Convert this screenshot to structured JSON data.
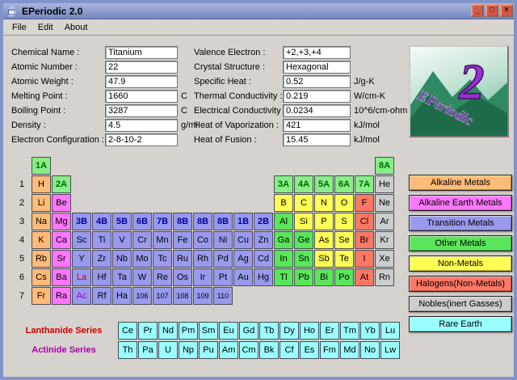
{
  "window": {
    "title": "EPeriodic 2.0",
    "menus": [
      "File",
      "Edit",
      "About"
    ],
    "controls": [
      {
        "name": "minimize-button",
        "glyph": "_"
      },
      {
        "name": "maximize-button",
        "glyph": "□"
      },
      {
        "name": "close-button",
        "glyph": "×"
      }
    ]
  },
  "form": {
    "left": [
      {
        "label": "Chemical Name :",
        "value": "Titanium",
        "unit": ""
      },
      {
        "label": "Atomic Number :",
        "value": "22",
        "unit": ""
      },
      {
        "label": "Atomic Weight :",
        "value": "47.9",
        "unit": ""
      },
      {
        "label": "Melting Point :",
        "value": "1660",
        "unit": "C"
      },
      {
        "label": "Boiling Point :",
        "value": "3287",
        "unit": "C"
      },
      {
        "label": "Density :",
        "value": "4.5",
        "unit": "g/ml"
      },
      {
        "label": "Electron Configuration :",
        "value": "2-8-10-2",
        "unit": ""
      }
    ],
    "right": [
      {
        "label": "Valence Electron :",
        "value": "+2,+3,+4",
        "unit": ""
      },
      {
        "label": "Crystal Structure :",
        "value": "Hexagonal",
        "unit": ""
      },
      {
        "label": "Specific Heat :",
        "value": "0.52",
        "unit": "J/g-K"
      },
      {
        "label": "Thermal Conductivity :",
        "value": "0.219",
        "unit": "W/cm-K"
      },
      {
        "label": "Electrical Conductivity :",
        "value": "0.0234",
        "unit": "10^6/cm-ohm"
      },
      {
        "label": "Heat of Vaporization :",
        "value": "421",
        "unit": "kJ/mol"
      },
      {
        "label": "Heat of Fusion :",
        "value": "15.45",
        "unit": "kJ/mol"
      }
    ]
  },
  "logo": {
    "numeral": "2",
    "text": "EPeriodic"
  },
  "colors": {
    "alkaline": "#ffbb77",
    "alkaline_earth": "#ff77ff",
    "transition": "#9999ee",
    "other_metal": "#5ae65a",
    "non_metal": "#ffff55",
    "halogen": "#ff7766",
    "noble": "#cccccc",
    "rare_earth": "#99ffff",
    "group_a_bg": "#88ee88",
    "group_a_text": "#006600",
    "group_b_bg": "#9999ee",
    "group_b_text": "#000099",
    "lanthanide_text": "#cc0000",
    "actinide_text": "#aa00aa"
  },
  "table": {
    "header": [
      {
        "label": "1A",
        "col": 1
      },
      {
        "label": "8A",
        "col": 18
      }
    ],
    "rows": [
      {
        "num": "1",
        "cells": [
          {
            "sym": "H",
            "col": 1,
            "cat": "alkaline"
          },
          {
            "sym": "2A",
            "col": 2,
            "cat": "group_a"
          },
          {
            "sym": "3A",
            "col": 13,
            "cat": "group_a"
          },
          {
            "sym": "4A",
            "col": 14,
            "cat": "group_a"
          },
          {
            "sym": "5A",
            "col": 15,
            "cat": "group_a"
          },
          {
            "sym": "6A",
            "col": 16,
            "cat": "group_a"
          },
          {
            "sym": "7A",
            "col": 17,
            "cat": "group_a"
          },
          {
            "sym": "He",
            "col": 18,
            "cat": "noble"
          }
        ]
      },
      {
        "num": "2",
        "cells": [
          {
            "sym": "Li",
            "col": 1,
            "cat": "alkaline"
          },
          {
            "sym": "Be",
            "col": 2,
            "cat": "alkaline_earth"
          },
          {
            "sym": "B",
            "col": 13,
            "cat": "non_metal"
          },
          {
            "sym": "C",
            "col": 14,
            "cat": "non_metal"
          },
          {
            "sym": "N",
            "col": 15,
            "cat": "non_metal"
          },
          {
            "sym": "O",
            "col": 16,
            "cat": "non_metal"
          },
          {
            "sym": "F",
            "col": 17,
            "cat": "halogen"
          },
          {
            "sym": "Ne",
            "col": 18,
            "cat": "noble"
          }
        ]
      },
      {
        "num": "3",
        "cells": [
          {
            "sym": "Na",
            "col": 1,
            "cat": "alkaline"
          },
          {
            "sym": "Mg",
            "col": 2,
            "cat": "alkaline_earth"
          },
          {
            "sym": "3B",
            "col": 3,
            "cat": "group_b"
          },
          {
            "sym": "4B",
            "col": 4,
            "cat": "group_b"
          },
          {
            "sym": "5B",
            "col": 5,
            "cat": "group_b"
          },
          {
            "sym": "6B",
            "col": 6,
            "cat": "group_b"
          },
          {
            "sym": "7B",
            "col": 7,
            "cat": "group_b"
          },
          {
            "sym": "8B",
            "col": 8,
            "cat": "group_b"
          },
          {
            "sym": "8B",
            "col": 9,
            "cat": "group_b"
          },
          {
            "sym": "8B",
            "col": 10,
            "cat": "group_b"
          },
          {
            "sym": "1B",
            "col": 11,
            "cat": "group_b"
          },
          {
            "sym": "2B",
            "col": 12,
            "cat": "group_b"
          },
          {
            "sym": "Al",
            "col": 13,
            "cat": "other_metal"
          },
          {
            "sym": "Si",
            "col": 14,
            "cat": "non_metal"
          },
          {
            "sym": "P",
            "col": 15,
            "cat": "non_metal"
          },
          {
            "sym": "S",
            "col": 16,
            "cat": "non_metal"
          },
          {
            "sym": "Cl",
            "col": 17,
            "cat": "halogen"
          },
          {
            "sym": "Ar",
            "col": 18,
            "cat": "noble"
          }
        ]
      },
      {
        "num": "4",
        "cells": [
          {
            "sym": "K",
            "col": 1,
            "cat": "alkaline"
          },
          {
            "sym": "Ca",
            "col": 2,
            "cat": "alkaline_earth"
          },
          {
            "sym": "Sc",
            "col": 3,
            "cat": "transition"
          },
          {
            "sym": "Ti",
            "col": 4,
            "cat": "transition"
          },
          {
            "sym": "V",
            "col": 5,
            "cat": "transition"
          },
          {
            "sym": "Cr",
            "col": 6,
            "cat": "transition"
          },
          {
            "sym": "Mn",
            "col": 7,
            "cat": "transition"
          },
          {
            "sym": "Fe",
            "col": 8,
            "cat": "transition"
          },
          {
            "sym": "Co",
            "col": 9,
            "cat": "transition"
          },
          {
            "sym": "Ni",
            "col": 10,
            "cat": "transition"
          },
          {
            "sym": "Cu",
            "col": 11,
            "cat": "transition"
          },
          {
            "sym": "Zn",
            "col": 12,
            "cat": "transition"
          },
          {
            "sym": "Ga",
            "col": 13,
            "cat": "other_metal"
          },
          {
            "sym": "Ge",
            "col": 14,
            "cat": "other_metal"
          },
          {
            "sym": "As",
            "col": 15,
            "cat": "non_metal"
          },
          {
            "sym": "Se",
            "col": 16,
            "cat": "non_metal"
          },
          {
            "sym": "Br",
            "col": 17,
            "cat": "halogen"
          },
          {
            "sym": "Kr",
            "col": 18,
            "cat": "noble"
          }
        ]
      },
      {
        "num": "5",
        "cells": [
          {
            "sym": "Rb",
            "col": 1,
            "cat": "alkaline"
          },
          {
            "sym": "Sr",
            "col": 2,
            "cat": "alkaline_earth"
          },
          {
            "sym": "Y",
            "col": 3,
            "cat": "transition"
          },
          {
            "sym": "Zr",
            "col": 4,
            "cat": "transition"
          },
          {
            "sym": "Nb",
            "col": 5,
            "cat": "transition"
          },
          {
            "sym": "Mo",
            "col": 6,
            "cat": "transition"
          },
          {
            "sym": "Tc",
            "col": 7,
            "cat": "transition"
          },
          {
            "sym": "Ru",
            "col": 8,
            "cat": "transition"
          },
          {
            "sym": "Rh",
            "col": 9,
            "cat": "transition"
          },
          {
            "sym": "Pd",
            "col": 10,
            "cat": "transition"
          },
          {
            "sym": "Ag",
            "col": 11,
            "cat": "transition"
          },
          {
            "sym": "Cd",
            "col": 12,
            "cat": "transition"
          },
          {
            "sym": "In",
            "col": 13,
            "cat": "other_metal"
          },
          {
            "sym": "Sn",
            "col": 14,
            "cat": "other_metal"
          },
          {
            "sym": "Sb",
            "col": 15,
            "cat": "non_metal"
          },
          {
            "sym": "Te",
            "col": 16,
            "cat": "non_metal"
          },
          {
            "sym": "I",
            "col": 17,
            "cat": "halogen"
          },
          {
            "sym": "Xe",
            "col": 18,
            "cat": "noble"
          }
        ]
      },
      {
        "num": "6",
        "cells": [
          {
            "sym": "Cs",
            "col": 1,
            "cat": "alkaline"
          },
          {
            "sym": "Ba",
            "col": 2,
            "cat": "alkaline_earth"
          },
          {
            "sym": "La",
            "col": 3,
            "cat": "transition",
            "fg": "lanthanide_text"
          },
          {
            "sym": "Hf",
            "col": 4,
            "cat": "transition"
          },
          {
            "sym": "Ta",
            "col": 5,
            "cat": "transition"
          },
          {
            "sym": "W",
            "col": 6,
            "cat": "transition"
          },
          {
            "sym": "Re",
            "col": 7,
            "cat": "transition"
          },
          {
            "sym": "Os",
            "col": 8,
            "cat": "transition"
          },
          {
            "sym": "Ir",
            "col": 9,
            "cat": "transition"
          },
          {
            "sym": "Pt",
            "col": 10,
            "cat": "transition"
          },
          {
            "sym": "Au",
            "col": 11,
            "cat": "transition"
          },
          {
            "sym": "Hg",
            "col": 12,
            "cat": "transition"
          },
          {
            "sym": "Tl",
            "col": 13,
            "cat": "other_metal"
          },
          {
            "sym": "Pb",
            "col": 14,
            "cat": "other_metal"
          },
          {
            "sym": "Bi",
            "col": 15,
            "cat": "other_metal"
          },
          {
            "sym": "Po",
            "col": 16,
            "cat": "other_metal"
          },
          {
            "sym": "At",
            "col": 17,
            "cat": "halogen"
          },
          {
            "sym": "Rn",
            "col": 18,
            "cat": "noble"
          }
        ]
      },
      {
        "num": "7",
        "cells": [
          {
            "sym": "Fr",
            "col": 1,
            "cat": "alkaline"
          },
          {
            "sym": "Ra",
            "col": 2,
            "cat": "alkaline_earth"
          },
          {
            "sym": "Ac",
            "col": 3,
            "cat": "transition",
            "fg": "actinide_text"
          },
          {
            "sym": "Rf",
            "col": 4,
            "cat": "transition"
          },
          {
            "sym": "Ha",
            "col": 5,
            "cat": "transition"
          },
          {
            "sym": "106",
            "col": 6,
            "cat": "transition"
          },
          {
            "sym": "107",
            "col": 7,
            "cat": "transition"
          },
          {
            "sym": "108",
            "col": 8,
            "cat": "transition"
          },
          {
            "sym": "109",
            "col": 9,
            "cat": "transition"
          },
          {
            "sym": "110",
            "col": 10,
            "cat": "transition"
          }
        ]
      }
    ]
  },
  "legend": [
    {
      "label": "Alkaline Metals",
      "cat": "alkaline"
    },
    {
      "label": "Alkaline Earth Metals",
      "cat": "alkaline_earth"
    },
    {
      "label": "Transition Metals",
      "cat": "transition"
    },
    {
      "label": "Other Metals",
      "cat": "other_metal"
    },
    {
      "label": "Non-Metals",
      "cat": "non_metal"
    },
    {
      "label": "Halogens(Non-Metals)",
      "cat": "halogen"
    },
    {
      "label": "Nobles(inert Gasses)",
      "cat": "noble"
    },
    {
      "label": "Rare Earth",
      "cat": "rare_earth"
    }
  ],
  "series": [
    {
      "label": "Lanthanide Series",
      "color_key": "lanthanide_text",
      "cells": [
        "Ce",
        "Pr",
        "Nd",
        "Pm",
        "Sm",
        "Eu",
        "Gd",
        "Tb",
        "Dy",
        "Ho",
        "Er",
        "Tm",
        "Yb",
        "Lu"
      ]
    },
    {
      "label": "Actinide Series",
      "color_key": "actinide_text",
      "cells": [
        "Th",
        "Pa",
        "U",
        "Np",
        "Pu",
        "Am",
        "Cm",
        "Bk",
        "Cf",
        "Es",
        "Fm",
        "Md",
        "No",
        "Lw"
      ]
    }
  ]
}
